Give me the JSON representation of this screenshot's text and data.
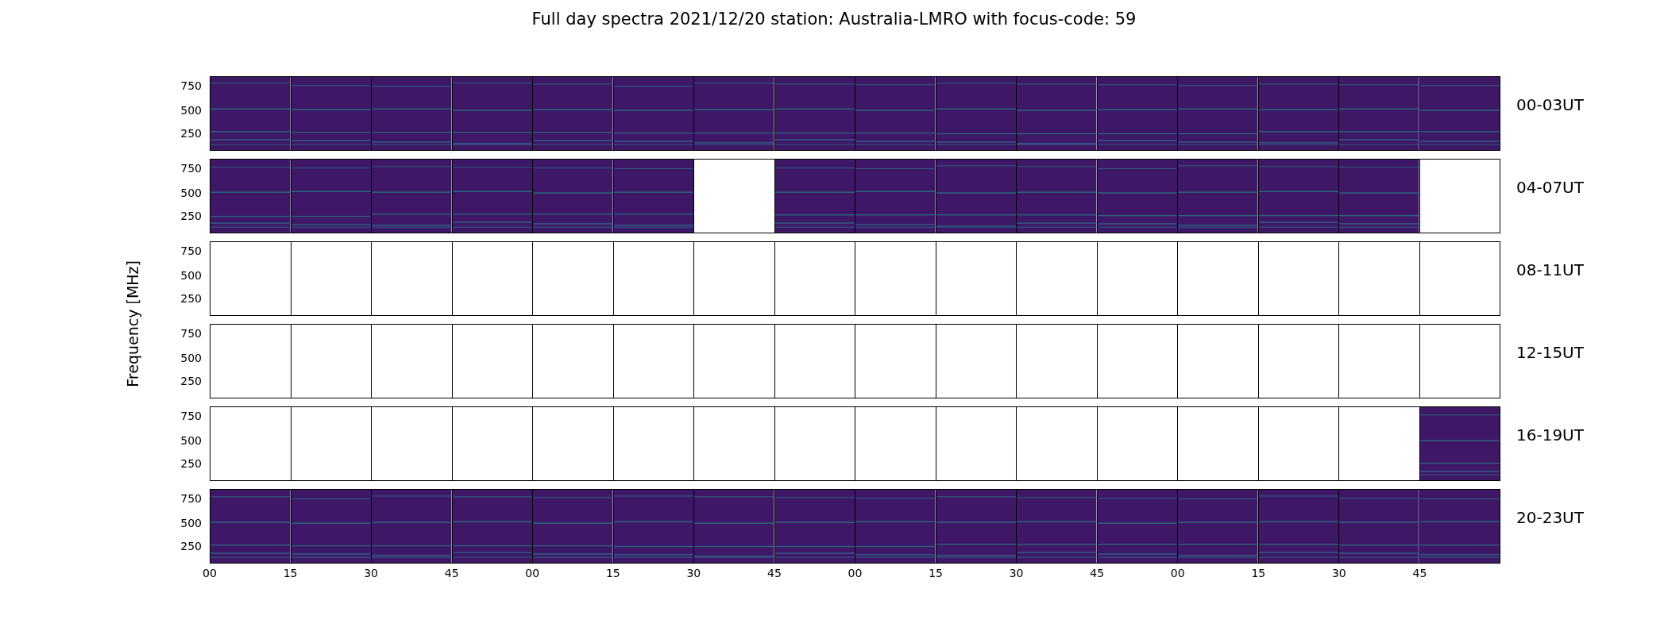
{
  "title": "Full day spectra 2021/12/20 station: Australia-LMRO with focus-code: 59",
  "y_axis_label": "Frequency [MHz]",
  "rows": [
    {
      "label": "00-03UT",
      "yticks": [
        "750",
        "500",
        "250"
      ],
      "panels": [
        {
          "kind": "spectrum"
        },
        {
          "kind": "spectrum"
        },
        {
          "kind": "spectrum"
        },
        {
          "kind": "spectrum"
        },
        {
          "kind": "spectrum"
        },
        {
          "kind": "spectrum"
        },
        {
          "kind": "spectrum"
        },
        {
          "kind": "spectrum"
        },
        {
          "kind": "spectrum"
        },
        {
          "kind": "spectrum"
        },
        {
          "kind": "spectrum"
        },
        {
          "kind": "spectrum"
        },
        {
          "kind": "spectrum"
        },
        {
          "kind": "spectrum"
        },
        {
          "kind": "spectrum"
        },
        {
          "kind": "spectrum"
        }
      ]
    },
    {
      "label": "04-07UT",
      "yticks": [
        "750",
        "500",
        "250"
      ],
      "panels": [
        {
          "kind": "spectrum"
        },
        {
          "kind": "spectrum"
        },
        {
          "kind": "spectrum"
        },
        {
          "kind": "spectrum"
        },
        {
          "kind": "spectrum"
        },
        {
          "kind": "spectrum"
        },
        {
          "kind": "empty"
        },
        {
          "kind": "spectrum"
        },
        {
          "kind": "spectrum"
        },
        {
          "kind": "spectrum"
        },
        {
          "kind": "spectrum"
        },
        {
          "kind": "spectrum"
        },
        {
          "kind": "spectrum"
        },
        {
          "kind": "spectrum"
        },
        {
          "kind": "spectrum"
        },
        {
          "kind": "empty"
        }
      ]
    },
    {
      "label": "08-11UT",
      "yticks": [
        "750",
        "500",
        "250"
      ],
      "panels": [
        {
          "kind": "empty"
        },
        {
          "kind": "empty"
        },
        {
          "kind": "empty"
        },
        {
          "kind": "empty"
        },
        {
          "kind": "empty"
        },
        {
          "kind": "empty"
        },
        {
          "kind": "empty"
        },
        {
          "kind": "empty"
        },
        {
          "kind": "empty"
        },
        {
          "kind": "empty"
        },
        {
          "kind": "empty"
        },
        {
          "kind": "empty"
        },
        {
          "kind": "empty"
        },
        {
          "kind": "empty"
        },
        {
          "kind": "empty"
        },
        {
          "kind": "empty"
        }
      ]
    },
    {
      "label": "12-15UT",
      "yticks": [
        "750",
        "500",
        "250"
      ],
      "panels": [
        {
          "kind": "empty"
        },
        {
          "kind": "empty"
        },
        {
          "kind": "empty"
        },
        {
          "kind": "empty"
        },
        {
          "kind": "empty"
        },
        {
          "kind": "empty"
        },
        {
          "kind": "empty"
        },
        {
          "kind": "empty"
        },
        {
          "kind": "empty"
        },
        {
          "kind": "empty"
        },
        {
          "kind": "empty"
        },
        {
          "kind": "empty"
        },
        {
          "kind": "empty"
        },
        {
          "kind": "empty"
        },
        {
          "kind": "empty"
        },
        {
          "kind": "empty"
        }
      ]
    },
    {
      "label": "16-19UT",
      "yticks": [
        "750",
        "500",
        "250"
      ],
      "panels": [
        {
          "kind": "empty"
        },
        {
          "kind": "empty"
        },
        {
          "kind": "empty"
        },
        {
          "kind": "empty"
        },
        {
          "kind": "empty"
        },
        {
          "kind": "empty"
        },
        {
          "kind": "empty"
        },
        {
          "kind": "empty"
        },
        {
          "kind": "empty"
        },
        {
          "kind": "empty"
        },
        {
          "kind": "empty"
        },
        {
          "kind": "empty"
        },
        {
          "kind": "empty"
        },
        {
          "kind": "empty"
        },
        {
          "kind": "empty"
        },
        {
          "kind": "spectrum"
        }
      ]
    },
    {
      "label": "20-23UT",
      "yticks": [
        "750",
        "500",
        "250"
      ],
      "panels": [
        {
          "kind": "spectrum"
        },
        {
          "kind": "spectrum"
        },
        {
          "kind": "spectrum"
        },
        {
          "kind": "spectrum"
        },
        {
          "kind": "spectrum"
        },
        {
          "kind": "spectrum"
        },
        {
          "kind": "spectrum"
        },
        {
          "kind": "spectrum"
        },
        {
          "kind": "spectrum"
        },
        {
          "kind": "spectrum"
        },
        {
          "kind": "spectrum"
        },
        {
          "kind": "spectrum"
        },
        {
          "kind": "spectrum"
        },
        {
          "kind": "spectrum"
        },
        {
          "kind": "spectrum"
        },
        {
          "kind": "spectrum"
        }
      ]
    }
  ],
  "x_ticks": [
    "00",
    "15",
    "30",
    "45",
    "00",
    "15",
    "30",
    "45",
    "00",
    "15",
    "30",
    "45",
    "00",
    "15",
    "30",
    "45"
  ]
}
